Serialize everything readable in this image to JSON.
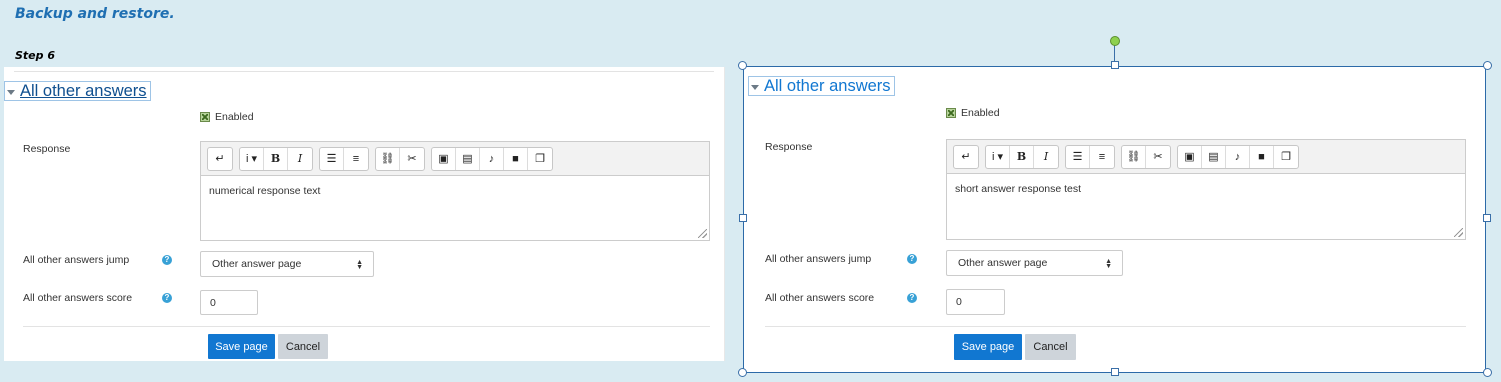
{
  "doc": {
    "title": "Backup and restore.",
    "step": "Step 6"
  },
  "panels": [
    {
      "section_title": "All other answers",
      "enabled_label": "Enabled",
      "response_label": "Response",
      "toolbar": [
        "↵",
        "i ▾",
        "B",
        "I",
        "bullet-list",
        "numbered-list",
        "link",
        "unlink",
        "image",
        "media-file",
        "microphone",
        "video",
        "copy"
      ],
      "response_text": "numerical response text",
      "jump_label": "All other answers jump",
      "jump_value": "Other answer page",
      "score_label": "All other answers score",
      "score_value": "0",
      "save_label": "Save page",
      "cancel_label": "Cancel"
    },
    {
      "section_title": "All other answers",
      "enabled_label": "Enabled",
      "response_label": "Response",
      "response_text": "short answer response test",
      "jump_label": "All other answers jump",
      "jump_value": "Other answer page",
      "score_label": "All other answers score",
      "score_value": "0",
      "save_label": "Save page",
      "cancel_label": "Cancel"
    }
  ],
  "help_glyph": "?",
  "colors": {
    "primary": "#1177d1",
    "background": "#d9ebf2",
    "heading": "#1f6fb2"
  }
}
